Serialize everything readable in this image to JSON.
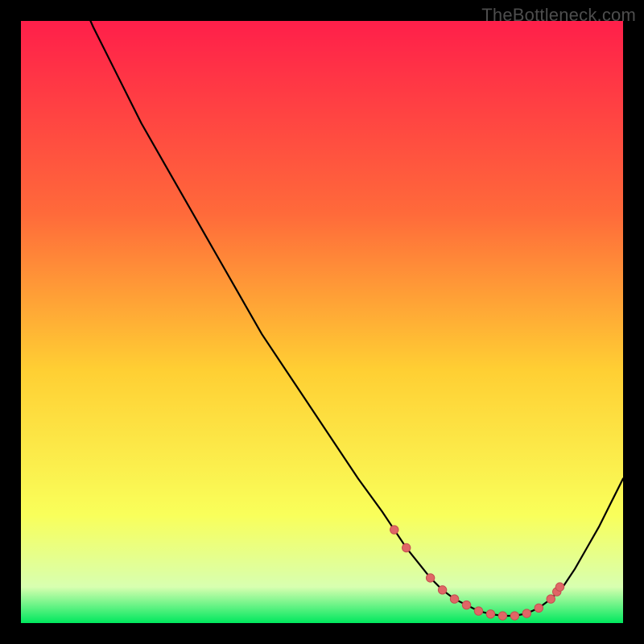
{
  "watermark": "TheBottleneck.com",
  "colors": {
    "bg": "#000000",
    "gradient_top": "#ff1f4a",
    "gradient_mid_upper": "#ff6a3a",
    "gradient_mid": "#ffcf33",
    "gradient_lower": "#f9ff5a",
    "gradient_bottom_band": "#d8ffb0",
    "gradient_bottom": "#00e85e",
    "curve": "#000000",
    "dot_fill": "#e06666",
    "dot_stroke": "#c44f4f"
  },
  "chart_data": {
    "type": "line",
    "title": "",
    "xlabel": "",
    "ylabel": "",
    "xlim": [
      0,
      100
    ],
    "ylim": [
      0,
      100
    ],
    "x": [
      0,
      4,
      8,
      12,
      16,
      20,
      24,
      28,
      32,
      36,
      40,
      44,
      48,
      52,
      56,
      60,
      62,
      64,
      66,
      68,
      70,
      72,
      74,
      76,
      78,
      80,
      82,
      84,
      86,
      88,
      90,
      92,
      94,
      96,
      98,
      100
    ],
    "values": [
      124,
      116,
      108,
      99,
      91,
      83,
      76,
      69,
      62,
      55,
      48,
      42,
      36,
      30,
      24,
      18.5,
      15.5,
      12.5,
      10,
      7.5,
      5.5,
      4,
      3,
      2,
      1.5,
      1.2,
      1.2,
      1.6,
      2.5,
      4,
      6,
      9,
      12.5,
      16,
      20,
      24
    ],
    "annotations": {
      "dots_x": [
        62,
        64,
        68,
        70,
        72,
        74,
        76,
        78,
        80,
        82,
        84,
        86,
        88,
        89,
        89.5
      ],
      "dots_y": [
        15.5,
        12.5,
        7.5,
        5.5,
        4,
        3,
        2,
        1.5,
        1.2,
        1.2,
        1.6,
        2.5,
        4,
        5.2,
        6
      ]
    }
  }
}
